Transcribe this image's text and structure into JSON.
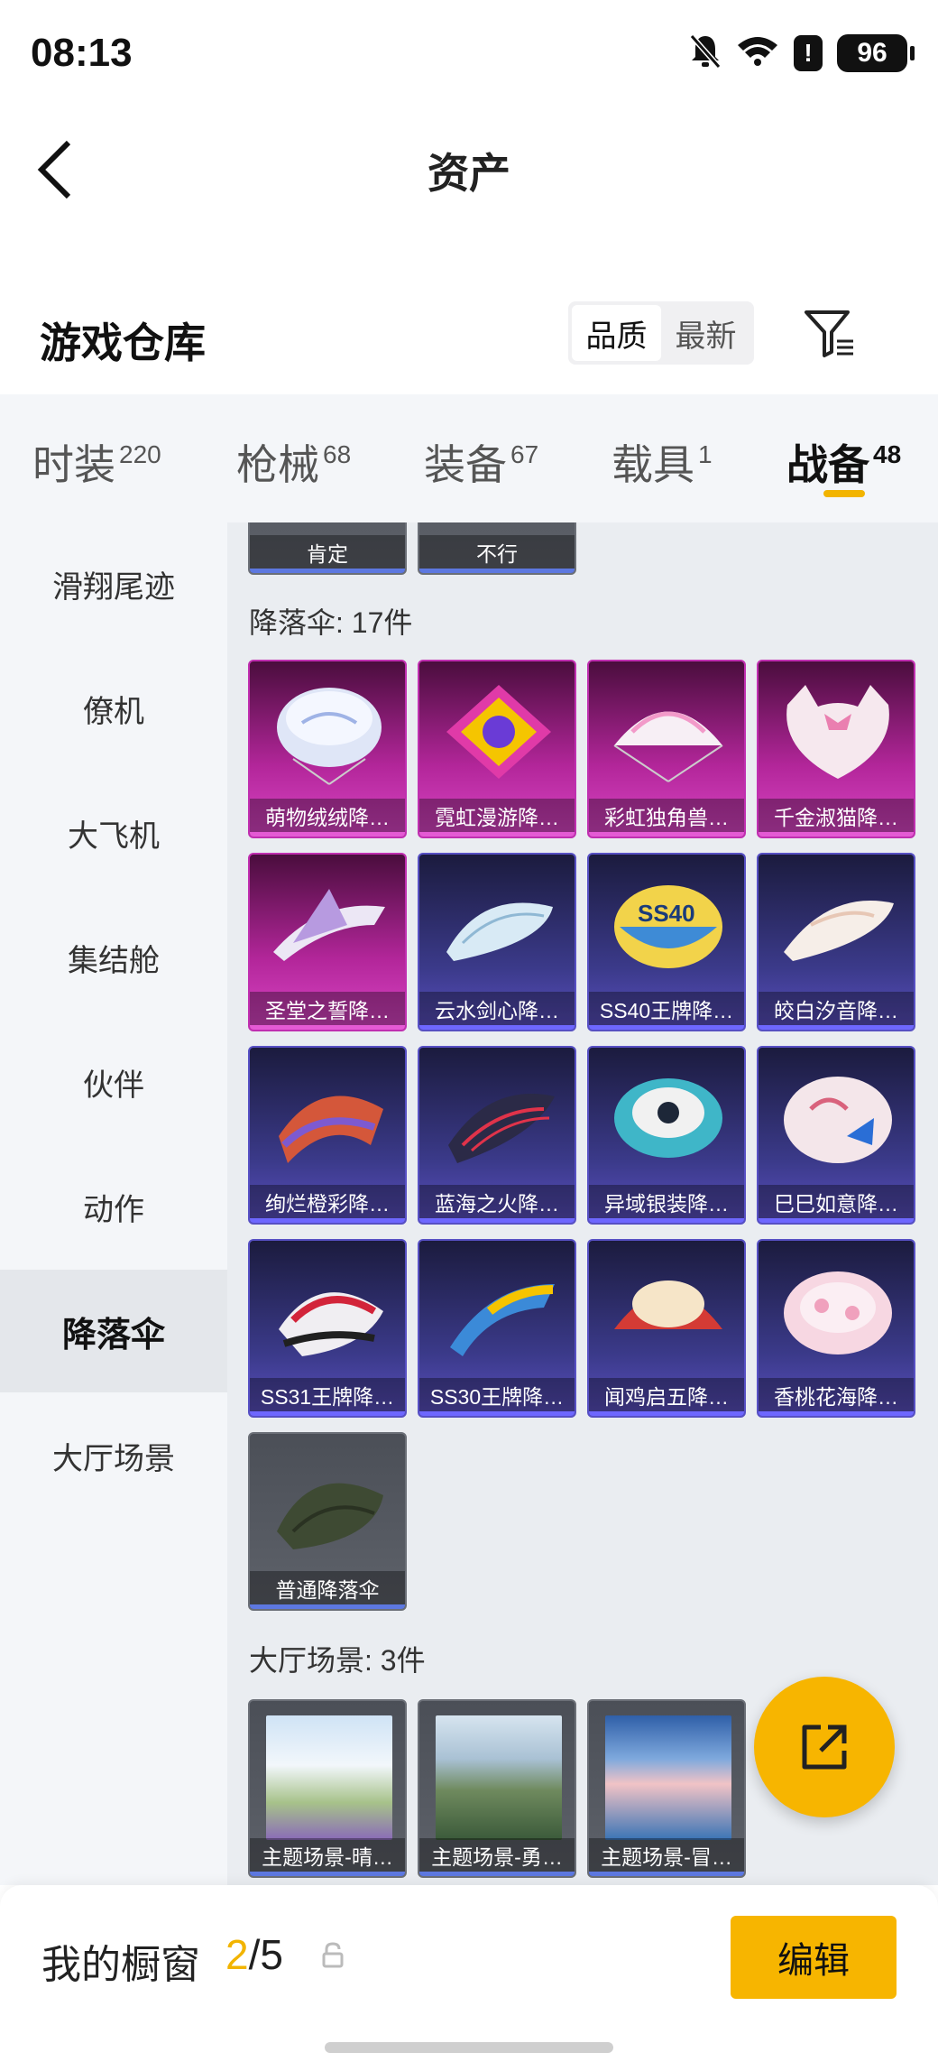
{
  "status_bar": {
    "time": "08:13",
    "battery": "96",
    "alert": "!"
  },
  "nav": {
    "title": "资产"
  },
  "warehouse": {
    "title": "游戏仓库",
    "sort_options": [
      "品质",
      "最新"
    ],
    "sort_active": "品质"
  },
  "tabs": [
    {
      "label": "时装",
      "count": "220"
    },
    {
      "label": "枪械",
      "count": "68"
    },
    {
      "label": "装备",
      "count": "67"
    },
    {
      "label": "载具",
      "count": "1"
    },
    {
      "label": "战备",
      "count": "48"
    }
  ],
  "sidebar": {
    "items": [
      "滑翔尾迹",
      "僚机",
      "大飞机",
      "集结舱",
      "伙伴",
      "动作",
      "降落伞",
      "大厅场景"
    ],
    "active": "降落伞"
  },
  "content": {
    "top_partial": [
      "肯定",
      "不行"
    ],
    "parachute_section": "降落伞: 17件",
    "parachutes": [
      {
        "name": "萌物绒绒降…",
        "rarity": "legendary"
      },
      {
        "name": "霓虹漫游降…",
        "rarity": "legendary"
      },
      {
        "name": "彩虹独角兽…",
        "rarity": "legendary"
      },
      {
        "name": "千金淑猫降…",
        "rarity": "legendary"
      },
      {
        "name": "圣堂之誓降…",
        "rarity": "legendary"
      },
      {
        "name": "云水剑心降…",
        "rarity": "epic"
      },
      {
        "name": "SS40王牌降…",
        "rarity": "epic"
      },
      {
        "name": "皎白汐音降…",
        "rarity": "epic"
      },
      {
        "name": "绚烂橙彩降…",
        "rarity": "epic"
      },
      {
        "name": "蓝海之火降…",
        "rarity": "epic"
      },
      {
        "name": "异域银装降…",
        "rarity": "epic"
      },
      {
        "name": "巳巳如意降…",
        "rarity": "epic"
      },
      {
        "name": "SS31王牌降…",
        "rarity": "epic"
      },
      {
        "name": "SS30王牌降…",
        "rarity": "epic"
      },
      {
        "name": "闻鸡启五降…",
        "rarity": "epic"
      },
      {
        "name": "香桃花海降…",
        "rarity": "epic"
      },
      {
        "name": "普通降落伞",
        "rarity": "common"
      }
    ],
    "lobby_section": "大厅场景: 3件",
    "lobby_scenes": [
      {
        "name": "主题场景-晴…"
      },
      {
        "name": "主题场景-勇…"
      },
      {
        "name": "主题场景-冒…"
      }
    ]
  },
  "bottom": {
    "showcase_label": "我的橱窗",
    "showcase_current": "2",
    "showcase_total": "/5",
    "edit_label": "编辑"
  },
  "colors": {
    "accent": "#f7b500",
    "legendary": "#c02fb0",
    "epic": "#5750c4"
  }
}
